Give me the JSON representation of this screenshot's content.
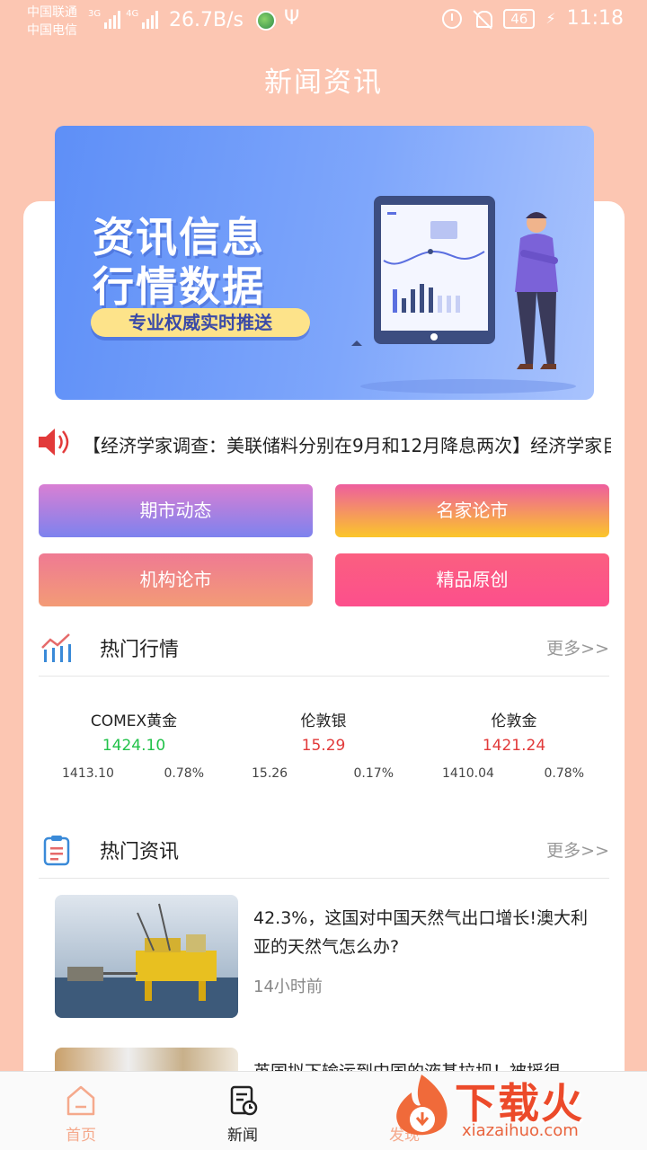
{
  "status_bar": {
    "carrier_1": "中国联通",
    "carrier_2": "中国电信",
    "network_1": "3G",
    "network_2": "4G",
    "speed": "26.7B/s",
    "battery": "46",
    "time": "11:18",
    "icons": [
      "signal-icon",
      "globe-app-icon",
      "usb-icon",
      "alarm-icon",
      "mute-icon",
      "battery-icon",
      "charging-icon"
    ]
  },
  "header": {
    "title": "新闻资讯"
  },
  "banner": {
    "headline_1": "资讯信息",
    "headline_2": "行情数据",
    "tagline": "专业权威实时推送"
  },
  "marquee": {
    "icon": "speaker-icon",
    "text": "【经济学家调查：美联储料分别在9月和12月降息两次】经济学家目"
  },
  "categories": [
    {
      "label": "期市动态"
    },
    {
      "label": "名家论市"
    },
    {
      "label": "机构论市"
    },
    {
      "label": "精品原创"
    }
  ],
  "market_section": {
    "icon": "chart-icon",
    "title": "热门行情",
    "more": "更多>>",
    "quotes": [
      {
        "name": "COMEX黄金",
        "price": "1424.10",
        "prev": "1413.10",
        "pct": "0.78%",
        "color": "#22c24a"
      },
      {
        "name": "伦敦银",
        "price": "15.29",
        "prev": "15.26",
        "pct": "0.17%",
        "color": "#e23a3a"
      },
      {
        "name": "伦敦金",
        "price": "1421.24",
        "prev": "1410.04",
        "pct": "0.78%",
        "color": "#e23a3a"
      }
    ]
  },
  "news_section": {
    "icon": "clipboard-icon",
    "title": "热门资讯",
    "more": "更多>>",
    "items": [
      {
        "title": "42.3%，这国对中国天然气出口增长!澳大利亚的天然气怎么办?",
        "time": "14小时前"
      },
      {
        "title": "英国拟下输运到中国的液基拉坝！被摇很"
      }
    ]
  },
  "tabbar": {
    "tabs": [
      {
        "label": "首页",
        "icon": "home-icon"
      },
      {
        "label": "新闻",
        "icon": "news-icon"
      },
      {
        "label": "发现",
        "icon": "discover-icon"
      }
    ]
  },
  "watermark": {
    "text": "下载火",
    "url": "xiazaihuo.com"
  },
  "colors": {
    "header_bg": "#fcc6b2",
    "accent": "#f5a98c",
    "up": "#e23a3a",
    "down": "#22c24a"
  }
}
